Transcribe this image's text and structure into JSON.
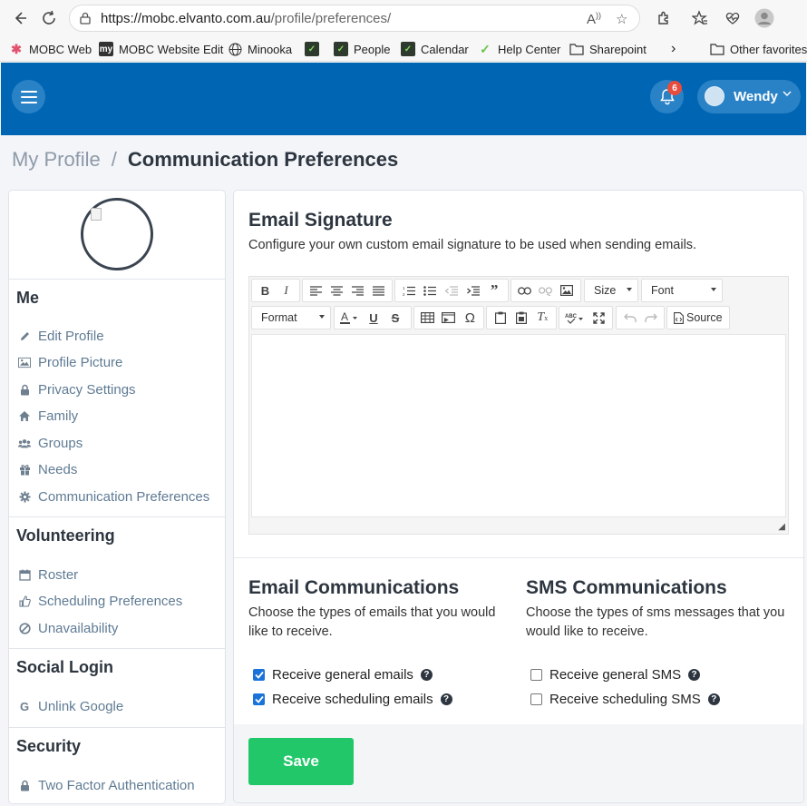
{
  "browser": {
    "url_host": "https://mobc.elvanto.com.au",
    "url_path": "/profile/preferences/",
    "bookmarks": [
      {
        "label": "MOBC Web"
      },
      {
        "label": "MOBC Website Edit"
      },
      {
        "label": "Minooka"
      },
      {
        "label": ""
      },
      {
        "label": "People"
      },
      {
        "label": "Calendar"
      },
      {
        "label": "Help Center"
      },
      {
        "label": "Sharepoint"
      }
    ],
    "more_bookmarks": "›",
    "other_favorites": "Other favorites"
  },
  "header": {
    "notification_count": "6",
    "user_name": "Wendy"
  },
  "breadcrumb": {
    "parent": "My Profile",
    "separator": "/",
    "current": "Communication Preferences"
  },
  "sidebar": {
    "me_heading": "Me",
    "me_items": [
      {
        "label": "Edit Profile"
      },
      {
        "label": "Profile Picture"
      },
      {
        "label": "Privacy Settings"
      },
      {
        "label": "Family"
      },
      {
        "label": "Groups"
      },
      {
        "label": "Needs"
      },
      {
        "label": "Communication Preferences"
      }
    ],
    "volunteering_heading": "Volunteering",
    "volunteering_items": [
      {
        "label": "Roster"
      },
      {
        "label": "Scheduling Preferences"
      },
      {
        "label": "Unavailability"
      }
    ],
    "social_heading": "Social Login",
    "social_items": [
      {
        "label": "Unlink Google"
      }
    ],
    "security_heading": "Security",
    "security_items": [
      {
        "label": "Two Factor Authentication"
      }
    ]
  },
  "signature": {
    "title": "Email Signature",
    "description": "Configure your own custom email signature to be used when sending emails.",
    "toolbar": {
      "size_label": "Size",
      "font_label": "Font",
      "format_label": "Format",
      "source_label": "Source"
    }
  },
  "email_comms": {
    "title": "Email Communications",
    "description": "Choose the types of emails that you would like to receive.",
    "options": [
      {
        "label": "Receive general emails",
        "checked": true
      },
      {
        "label": "Receive scheduling emails",
        "checked": true
      }
    ]
  },
  "sms_comms": {
    "title": "SMS Communications",
    "description": "Choose the types of sms messages that you would like to receive.",
    "options": [
      {
        "label": "Receive general SMS",
        "checked": false
      },
      {
        "label": "Receive scheduling SMS",
        "checked": false
      }
    ]
  },
  "actions": {
    "save_label": "Save"
  },
  "colors": {
    "header_blue": "#0066b3",
    "save_green": "#22c76a",
    "link_gray_blue": "#5f7b94",
    "checkbox_blue": "#1a73d9"
  }
}
